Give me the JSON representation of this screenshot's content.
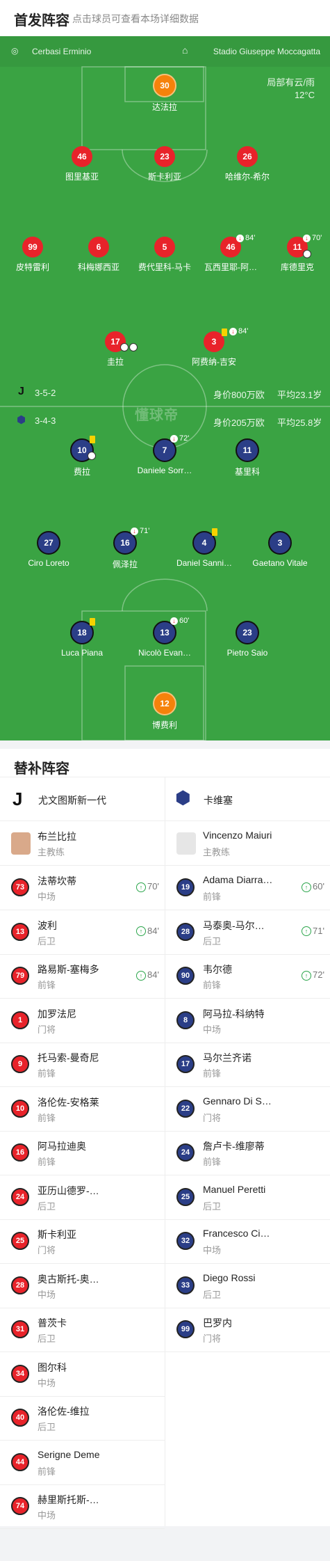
{
  "header": {
    "title": "首发阵容",
    "subtitle": "点击球员可查看本场详细数据"
  },
  "venue": {
    "referee": "Cerbasi Erminio",
    "stadium": "Stadio Giuseppe Moccagatta"
  },
  "weather": {
    "condition": "局部有云/雨",
    "temp": "12°C"
  },
  "watermark": "懂球帝",
  "home_info": {
    "formation": "3-5-2",
    "value": "身价800万欧",
    "age": "平均23.1岁"
  },
  "away_info": {
    "formation": "3-4-3",
    "value": "身价205万欧",
    "age": "平均25.8岁"
  },
  "home_players": [
    {
      "num": "30",
      "name": "达法拉"
    },
    {
      "num": "46",
      "name": "图里基亚"
    },
    {
      "num": "23",
      "name": "斯卡利亚"
    },
    {
      "num": "26",
      "name": "哈维尔-希尔"
    },
    {
      "num": "99",
      "name": "皮特雷利"
    },
    {
      "num": "6",
      "name": "科梅娜西亚"
    },
    {
      "num": "5",
      "name": "费代里科-马卡"
    },
    {
      "num": "46",
      "name": "瓦西里耶-阿…",
      "sub": "84'"
    },
    {
      "num": "11",
      "name": "库德里克",
      "sub": "70'"
    },
    {
      "num": "17",
      "name": "圭拉"
    },
    {
      "num": "3",
      "name": "阿费纳-吉安",
      "sub": "84'"
    }
  ],
  "away_players": [
    {
      "num": "10",
      "name": "费拉"
    },
    {
      "num": "7",
      "name": "Daniele Sorr…",
      "sub": "72'"
    },
    {
      "num": "11",
      "name": "基里科"
    },
    {
      "num": "27",
      "name": "Ciro Loreto"
    },
    {
      "num": "16",
      "name": "佩泽拉",
      "sub": "71'"
    },
    {
      "num": "4",
      "name": "Daniel Sanni…"
    },
    {
      "num": "3",
      "name": "Gaetano Vitale"
    },
    {
      "num": "18",
      "name": "Luca Piana"
    },
    {
      "num": "13",
      "name": "Nicolò Evan…",
      "sub": "60'"
    },
    {
      "num": "23",
      "name": "Pietro Saio"
    },
    {
      "num": "12",
      "name": "博费利"
    }
  ],
  "bench": {
    "title": "替补阵容",
    "home_team": "尤文图斯新一代",
    "away_team": "卡维塞",
    "home_coach": {
      "name": "布兰比拉",
      "role": "主教练"
    },
    "away_coach": {
      "name": "Vincenzo Maiuri",
      "role": "主教练"
    },
    "home": [
      {
        "num": "73",
        "name": "法蒂坎蒂",
        "pos": "中场",
        "min": "70'"
      },
      {
        "num": "13",
        "name": "波利",
        "pos": "后卫",
        "min": "84'"
      },
      {
        "num": "79",
        "name": "路易斯-塞梅多",
        "pos": "前锋",
        "min": "84'"
      },
      {
        "num": "1",
        "name": "加罗法尼",
        "pos": "门将"
      },
      {
        "num": "9",
        "name": "托马索-曼奇尼",
        "pos": "前锋"
      },
      {
        "num": "10",
        "name": "洛伦佐-安格莱",
        "pos": "前锋"
      },
      {
        "num": "16",
        "name": "阿马拉迪奥",
        "pos": "前锋"
      },
      {
        "num": "24",
        "name": "亚历山德罗-…",
        "pos": "后卫"
      },
      {
        "num": "25",
        "name": "斯卡利亚",
        "pos": "门将"
      },
      {
        "num": "28",
        "name": "奥古斯托-奥…",
        "pos": "中场"
      },
      {
        "num": "31",
        "name": "普茨卡",
        "pos": "后卫"
      },
      {
        "num": "34",
        "name": "图尔科",
        "pos": "中场"
      },
      {
        "num": "40",
        "name": "洛伦佐-维拉",
        "pos": "后卫"
      },
      {
        "num": "44",
        "name": "Serigne Deme",
        "pos": "前锋"
      },
      {
        "num": "74",
        "name": "赫里斯托斯-…",
        "pos": "中场"
      }
    ],
    "away": [
      {
        "num": "19",
        "name": "Adama Diarra…",
        "pos": "前锋",
        "min": "60'"
      },
      {
        "num": "28",
        "name": "马泰奥-马尔…",
        "pos": "后卫",
        "min": "71'"
      },
      {
        "num": "90",
        "name": "韦尔德",
        "pos": "前锋",
        "min": "72'"
      },
      {
        "num": "8",
        "name": "阿马拉-科纳特",
        "pos": "中场"
      },
      {
        "num": "17",
        "name": "马尔兰齐诺",
        "pos": "前锋"
      },
      {
        "num": "22",
        "name": "Gennaro Di S…",
        "pos": "门将"
      },
      {
        "num": "24",
        "name": "詹卢卡-维廖蒂",
        "pos": "前锋"
      },
      {
        "num": "25",
        "name": "Manuel Peretti",
        "pos": "后卫"
      },
      {
        "num": "32",
        "name": "Francesco Ci…",
        "pos": "中场"
      },
      {
        "num": "33",
        "name": "Diego Rossi",
        "pos": "后卫"
      },
      {
        "num": "99",
        "name": "巴罗内",
        "pos": "门将"
      }
    ]
  }
}
